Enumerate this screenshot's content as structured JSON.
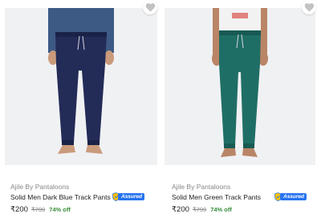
{
  "products": [
    {
      "brand": "Ajile By Pantaloons",
      "title": "Solid Men Dark Blue Track Pants",
      "price": "₹200",
      "mrp": "₹799",
      "discount": "74% off",
      "assured_label": "Assured",
      "pants_color": "#232b57",
      "top_color": "#3d5a85",
      "skin_color": "#c99a7b"
    },
    {
      "brand": "Ajile By Pantaloons",
      "title": "Solid Men Green Track Pants",
      "price": "₹200",
      "mrp": "₹799",
      "discount": "74% off",
      "assured_label": "Assured",
      "pants_color": "#1f6e66",
      "top_color": "#f2f2f2",
      "skin_color": "#b98566"
    }
  ],
  "colors": {
    "image_bg": "#f0f1f3",
    "assured_blue": "#2874f0",
    "discount_green": "#388e3c",
    "muted_text": "#878787"
  },
  "icons": {
    "wishlist": "heart-icon",
    "assured": "shield-icon"
  }
}
